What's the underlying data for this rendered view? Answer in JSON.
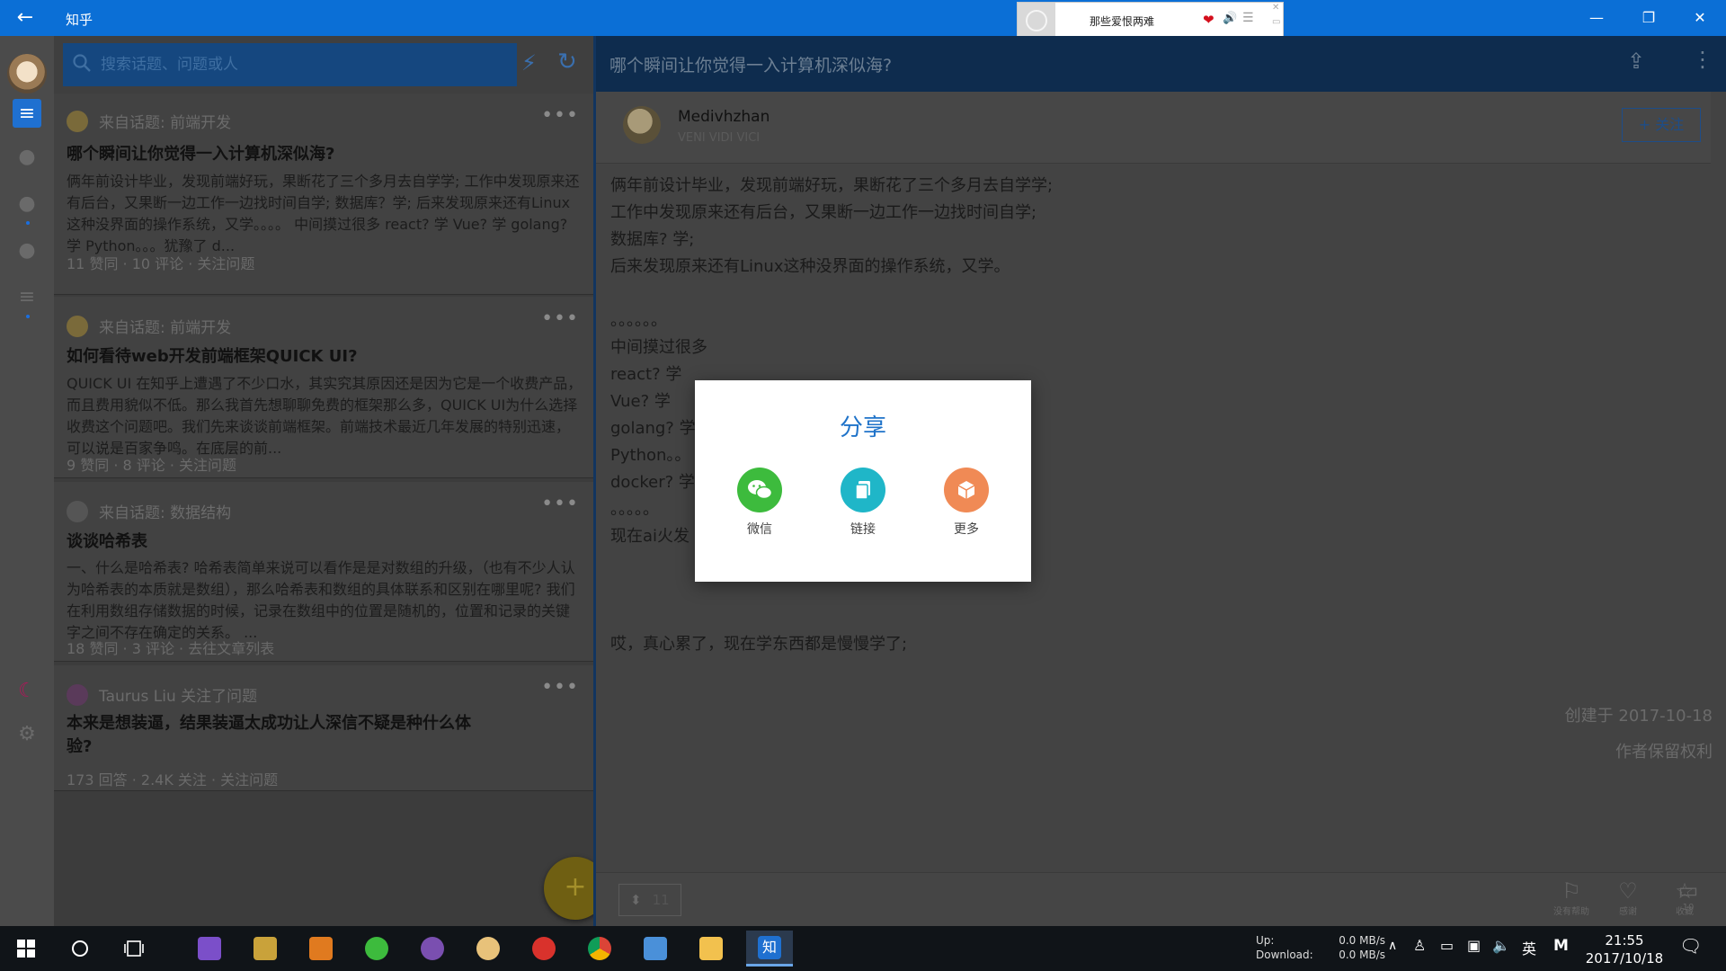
{
  "window": {
    "title": "知乎",
    "back_icon": "arrow-left-icon",
    "minimize": "—",
    "restore": "❐",
    "close": "✕"
  },
  "player": {
    "song": "那些爱恨两难",
    "heart": "❤",
    "volume": "🔊",
    "list": "☰",
    "close": "✕",
    "mini": "▭"
  },
  "search": {
    "placeholder": "搜索话题、问题或人"
  },
  "feed": [
    {
      "topic": "来自话题: 前端开发",
      "title": "哪个瞬间让你觉得一入计算机深似海?",
      "excerpt": "俩年前设计毕业，发现前端好玩，果断花了三个多月去自学学; 工作中发现原来还有后台，又果断一边工作一边找时间自学; 数据库？学; 后来发现原来还有Linux这种没界面的操作系统，又学。。。。 中间摸过很多 react? 学 Vue? 学 golang? 学 Python。。。犹豫了 d...",
      "meta": "11 赞同 · 10 评论 · 关注问题"
    },
    {
      "topic": "来自话题: 前端开发",
      "title": "如何看待web开发前端框架QUICK UI?",
      "excerpt": "QUICK UI 在知乎上遭遇了不少口水，其实究其原因还是因为它是一个收费产品，而且费用貌似不低。那么我首先想聊聊免费的框架那么多，QUICK UI为什么选择收费这个问题吧。我们先来谈谈前端框架。前端技术最近几年发展的特别迅速，可以说是百家争鸣。在底层的前...",
      "meta": "9 赞同 · 8 评论 · 关注问题"
    },
    {
      "topic": "来自话题: 数据结构",
      "title": "谈谈哈希表",
      "excerpt": "一、什么是哈希表? 哈希表简单来说可以看作是是对数组的升级，（也有不少人认为哈希表的本质就是数组），那么哈希表和数组的具体联系和区别在哪里呢? 我们在利用数组存储数据的时候，记录在数组中的位置是随机的，位置和记录的关键字之间不存在确定的关系。 ...",
      "meta": "18 赞同 · 3 评论 · 去往文章列表"
    },
    {
      "topic": "Taurus Liu 关注了问题",
      "title": "本来是想装逼，结果装逼太成功让人深信不疑是种什么体验?",
      "excerpt": "",
      "meta": "173 回答 · 2.4K 关注 · 关注问题"
    }
  ],
  "fab": "+",
  "detail": {
    "title": "哪个瞬间让你觉得一入计算机深似海?",
    "author": "Medivhzhan",
    "bio": "VENI VIDI VICI",
    "follow": "+ 关注",
    "lines": [
      "俩年前设计毕业，发现前端好玩，果断花了三个多月去自学学;",
      "工作中发现原来还有后台，又果断一边工作一边找时间自学;",
      "数据库? 学;",
      "后来发现原来还有Linux这种没界面的操作系统，又学。",
      "",
      "。。。。。。",
      "中间摸过很多",
      "react? 学",
      "Vue? 学",
      "golang? 学",
      "Python。。",
      "docker? 学",
      "。。。。。",
      "现在ai火发                                                   的大学课程;",
      "",
      "",
      "",
      "哎，真心累了，现在学东西都是慢慢学了;"
    ],
    "created": "创建于 2017-10-18",
    "rights": "作者保留权利",
    "votes": "11",
    "actions": [
      {
        "icon": "flag-icon",
        "glyph": "⚐",
        "label": "没有帮助"
      },
      {
        "icon": "heart-icon",
        "glyph": "♡",
        "label": "感谢"
      },
      {
        "icon": "star-icon",
        "glyph": "☆",
        "label": "收藏"
      },
      {
        "icon": "comment-icon",
        "glyph": "▭",
        "label": "10"
      }
    ]
  },
  "share_dialog": {
    "title": "分享",
    "options": [
      {
        "label": "微信",
        "icon": "wechat-icon",
        "color": "#3dbb3d"
      },
      {
        "label": "链接",
        "icon": "link-icon",
        "color": "#1fb6c8"
      },
      {
        "label": "更多",
        "icon": "box-icon",
        "color": "#f08a55"
      }
    ]
  },
  "taskbar": {
    "up_label": "Up:",
    "down_label": "Download:",
    "up_speed": "0.0 MB/s",
    "down_speed": "0.0 MB/s",
    "ime": "英",
    "ime2": "M",
    "time": "21:55",
    "date": "2017/10/18"
  }
}
